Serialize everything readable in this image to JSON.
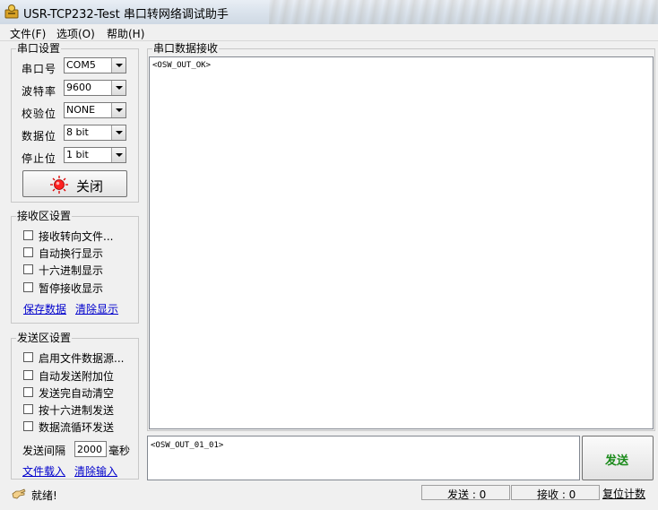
{
  "window": {
    "title": "USR-TCP232-Test 串口转网络调试助手"
  },
  "menu": {
    "file": "文件(F)",
    "options": "选项(O)",
    "help": "帮助(H)"
  },
  "serial_settings": {
    "title": "串口设置",
    "port": {
      "label": "串口号",
      "value": "COM5"
    },
    "baud": {
      "label": "波特率",
      "value": "9600"
    },
    "parity": {
      "label": "校验位",
      "value": "NONE"
    },
    "databits": {
      "label": "数据位",
      "value": "8 bit"
    },
    "stopbits": {
      "label": "停止位",
      "value": "1 bit"
    },
    "close_button": "关闭"
  },
  "receive_settings": {
    "title": "接收区设置",
    "options": [
      "接收转向文件...",
      "自动换行显示",
      "十六进制显示",
      "暂停接收显示"
    ],
    "save_link": "保存数据",
    "clear_link": "清除显示"
  },
  "send_settings": {
    "title": "发送区设置",
    "options": [
      "启用文件数据源...",
      "自动发送附加位",
      "发送完自动清空",
      "按十六进制发送",
      "数据流循环发送"
    ],
    "interval_label": "发送间隔",
    "interval_value": "2000",
    "interval_unit": "毫秒",
    "load_link": "文件载入",
    "clear_link": "清除输入"
  },
  "receive_area": {
    "title": "串口数据接收",
    "content": "<OSW_OUT_OK>"
  },
  "send_area": {
    "content": "<OSW_OUT_01_01>",
    "send_button": "发送"
  },
  "status": {
    "ready": "就绪!",
    "sent": "发送 : 0",
    "received": "接收 : 0",
    "reset": "复位计数"
  },
  "colors": {
    "send_button_text": "#1a8a1a",
    "close_icon": "#e00000",
    "link": "#0000cc"
  }
}
